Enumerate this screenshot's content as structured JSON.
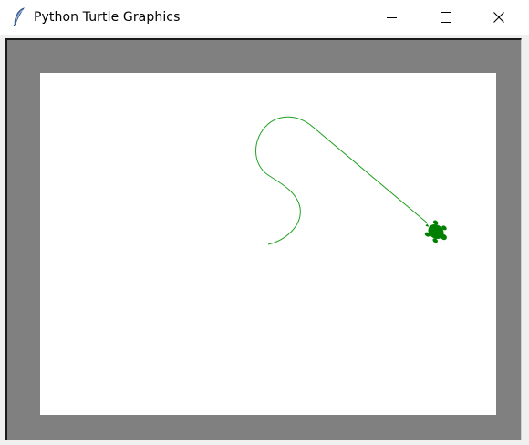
{
  "window": {
    "title": "Python Turtle Graphics",
    "app_icon": "feather-icon"
  },
  "title_controls": {
    "minimize_icon": "minimize-icon",
    "maximize_icon": "maximize-icon",
    "close_icon": "close-icon"
  },
  "canvas": {
    "background": "#ffffff",
    "frame_color": "#808080",
    "pen_color": "#22a022",
    "turtle_color": "#008000",
    "turtle_icon": "turtle-icon"
  }
}
